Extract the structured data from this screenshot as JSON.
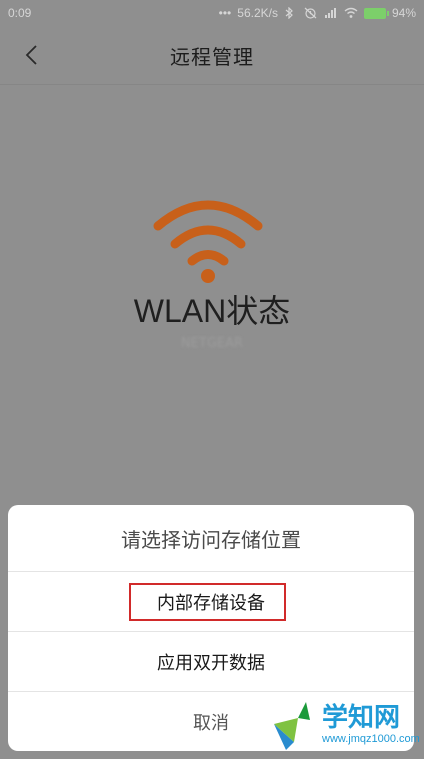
{
  "status_bar": {
    "time": "0:09",
    "dots": "•••",
    "network_speed": "56.2K/s",
    "battery": "94%"
  },
  "header": {
    "title": "远程管理"
  },
  "wlan": {
    "title": "WLAN状态",
    "network_name": "NETGEAR",
    "icon_color": "#c8601a"
  },
  "dialog": {
    "title": "请选择访问存储位置",
    "options": [
      {
        "label": "内部存储设备"
      },
      {
        "label": "应用双开数据"
      }
    ],
    "cancel_label": "取消",
    "highlight_color": "#d12a2a"
  },
  "watermark": {
    "main": "学知网",
    "sub": "www.jmqz1000.com"
  },
  "icons": [
    "back-icon",
    "bluetooth-icon",
    "alarm-icon",
    "signal-icon",
    "wifi-icon",
    "battery-icon",
    "wlan-icon"
  ]
}
